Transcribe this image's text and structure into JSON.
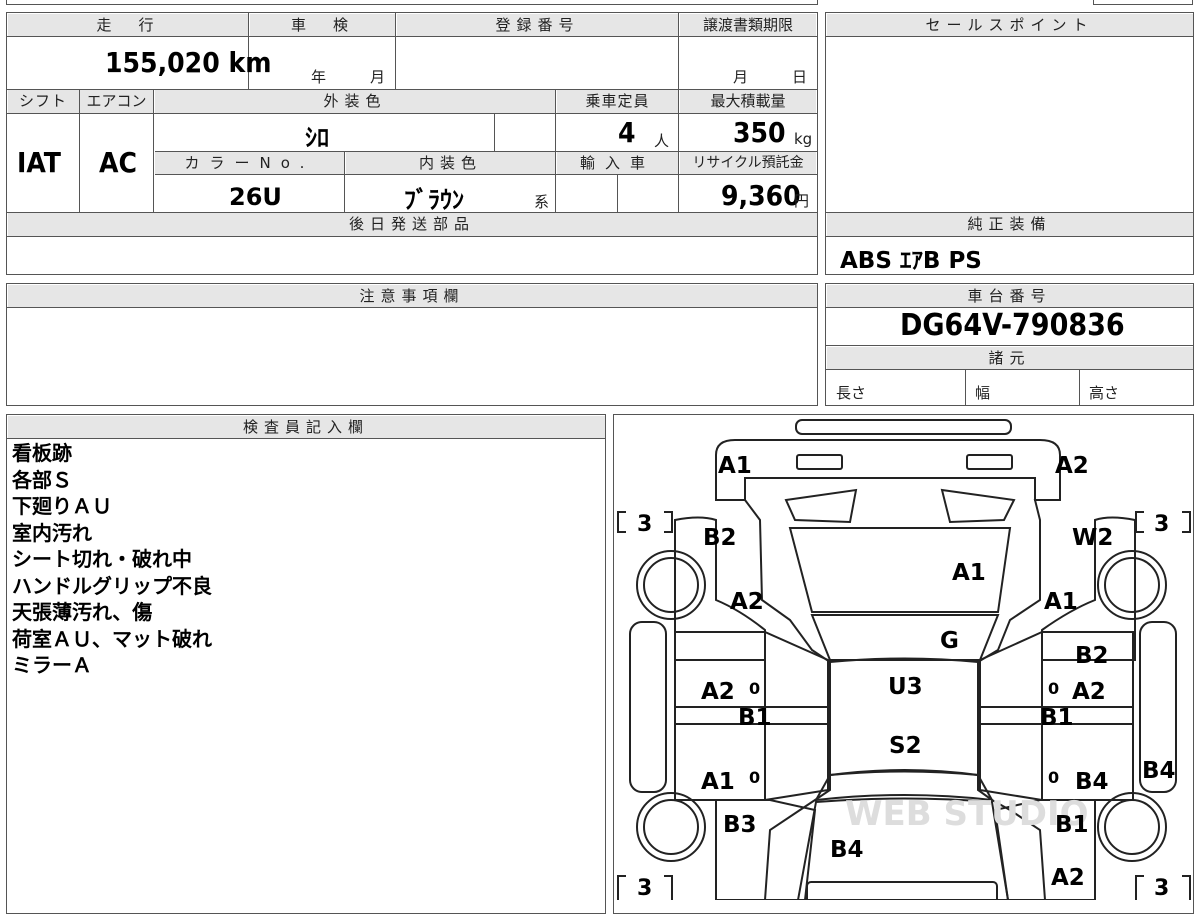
{
  "vehicle": {
    "mileage_header": "走　行",
    "mileage": "155,020 km",
    "shaken_header": "車　検",
    "shaken_year_label": "年",
    "shaken_month_label": "月",
    "registration_header": "登録番号",
    "transfer_header": "譲渡書類期限",
    "transfer_month_label": "月",
    "transfer_day_label": "日",
    "shift_header": "シフト",
    "shift": "IAT",
    "aircon_header": "エアコン",
    "aircon": "AC",
    "exterior_header": "外装色",
    "exterior_color": "ｼﾛ",
    "capacity_header": "乗車定員",
    "capacity": "4",
    "capacity_unit": "人",
    "load_header": "最大積載量",
    "load": "350",
    "load_unit": "kg",
    "color_no_header": "カラーNo.",
    "color_no": "26U",
    "interior_header": "内装色",
    "interior_color": "ﾌﾞﾗｳﾝ",
    "interior_suffix": "系",
    "import_header": "輸入車",
    "recycle_header": "リサイクル預託金",
    "recycle_fee": "9,360",
    "recycle_unit": "円",
    "later_parts_header": "後日発送部品",
    "sales_point_header": "セールスポイント",
    "equipment_header": "純正装備",
    "equipment": "ABS ｴｱB PS",
    "caution_header": "注意事項欄",
    "chassis_header": "車台番号",
    "chassis_no": "DG64V-790836",
    "specs_header": "諸元",
    "length_label": "長さ",
    "width_label": "幅",
    "height_label": "高さ"
  },
  "inspector": {
    "header": "検査員記入欄",
    "notes": [
      "看板跡",
      "各部Ｓ",
      "下廻りＡＵ",
      "室内汚れ",
      "シート切れ・破れ中",
      "ハンドルグリップ不良",
      "天張薄汚れ、傷",
      "荷室ＡＵ、マット破れ",
      "ミラーＡ"
    ]
  },
  "diagram": {
    "tire_left_front": "[ 3 ]",
    "tire_right_front": "[ 3 ]",
    "tire_left_rear": "[ 3",
    "tire_right_rear": "[ 3",
    "marks": {
      "front_bumper_left": "A1",
      "front_bumper_right": "A2",
      "left_front_fender_top": "B2",
      "left_front_fender": "A2",
      "hood": "A1",
      "right_front_fender_top": "W2",
      "right_front_fender": "A1",
      "windshield": "G",
      "roof": "U3",
      "left_front_door": "A2",
      "left_rocker": "B1",
      "left_rear_door": "A1",
      "right_front_door_top": "B2",
      "right_front_door": "A2",
      "right_rocker": "B1",
      "right_rear_door": "B4",
      "right_side": "B4",
      "rear_roof": "S2",
      "left_rear_quarter": "B3",
      "tailgate": "B4",
      "right_rear_quarter": "B1",
      "rear_bumper_right": "A2"
    },
    "zero_marks": [
      "0",
      "0",
      "0",
      "0"
    ],
    "watermark": "WEB STUDIO"
  }
}
